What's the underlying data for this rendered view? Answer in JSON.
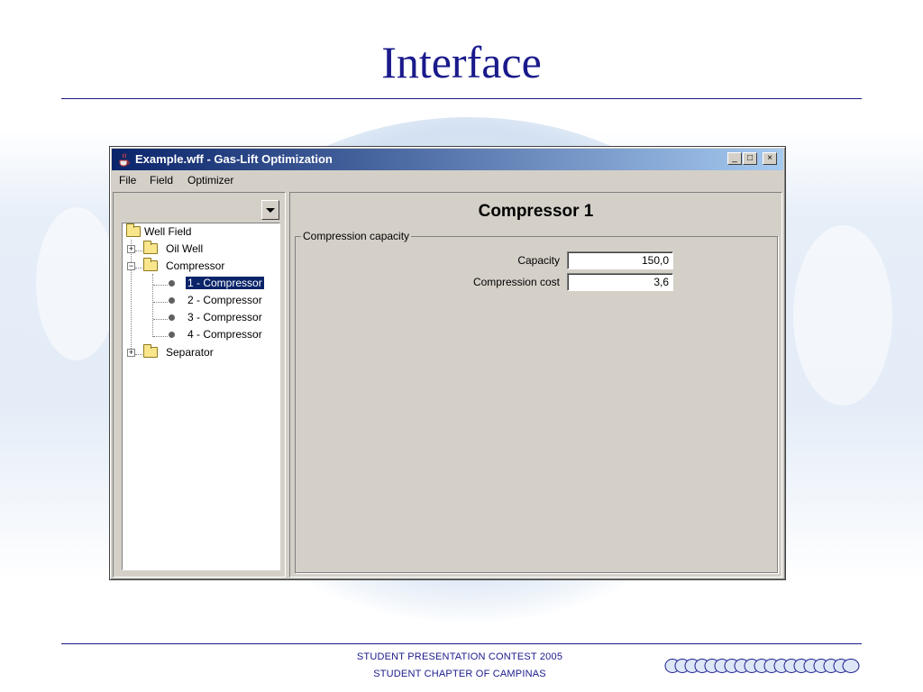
{
  "slide": {
    "title": "Interface",
    "footer_line1": "STUDENT PRESENTATION CONTEST 2005",
    "footer_line2": "STUDENT CHAPTER OF CAMPINAS",
    "accent_color": "#1a1a8c"
  },
  "window": {
    "title": "Example.wff - Gas-Lift Optimization",
    "icon": "java-cup-icon",
    "controls": {
      "minimize": "_",
      "maximize": "□",
      "close": "×"
    }
  },
  "menu": {
    "items": [
      "File",
      "Field",
      "Optimizer"
    ]
  },
  "tree": {
    "root": "Well Field",
    "oil_well": "Oil Well",
    "compressor": "Compressor",
    "compressor_children": [
      "1 - Compressor",
      "2 - Compressor",
      "3 - Compressor",
      "4 - Compressor"
    ],
    "separator": "Separator",
    "selected_index": 0
  },
  "panel": {
    "title": "Compressor 1",
    "group_label": "Compression capacity",
    "fields": [
      {
        "label": "Capacity",
        "value": "150,0"
      },
      {
        "label": "Compression cost",
        "value": "3,6"
      }
    ]
  }
}
